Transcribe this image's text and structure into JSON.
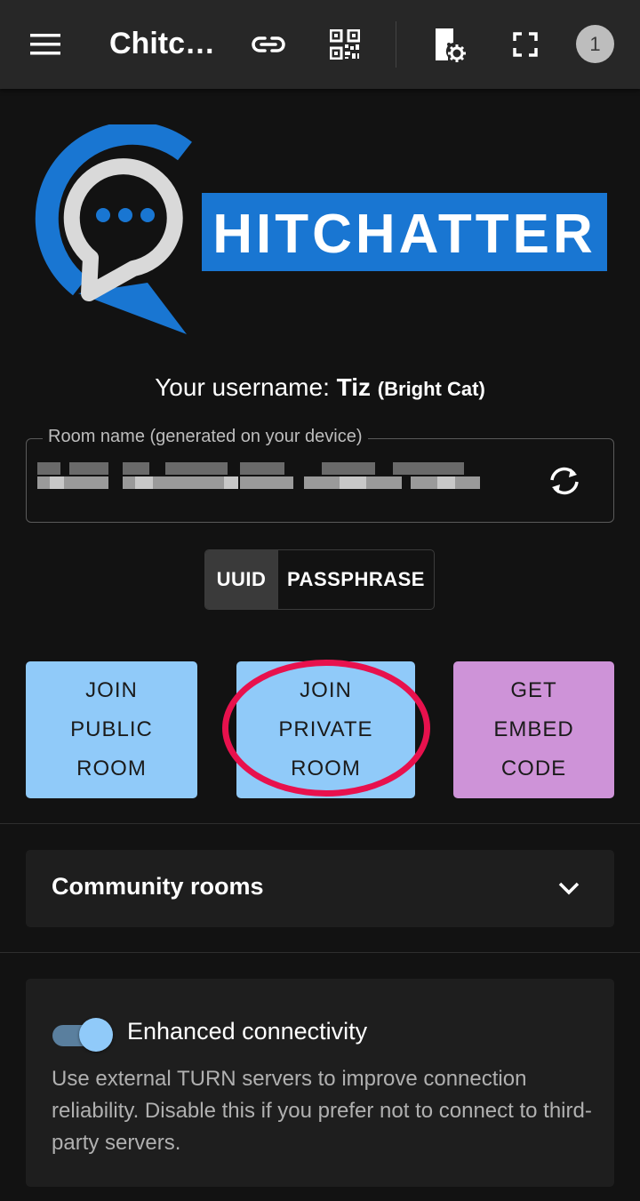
{
  "appbar": {
    "title": "Chitchatter",
    "badge_count": "1",
    "icons": [
      "menu-icon",
      "link-icon",
      "qr-code-icon",
      "room-settings-icon",
      "fullscreen-icon"
    ]
  },
  "logo": {
    "wordmark": "HITCHATTER"
  },
  "user": {
    "prefix": "Your username: ",
    "name": "Tiz",
    "nickname": "(Bright Cat)"
  },
  "room_field": {
    "label": "Room name (generated on your device)",
    "value_obscured": true
  },
  "room_type": {
    "options": [
      "UUID",
      "PASSPHRASE"
    ],
    "selected": "UUID"
  },
  "actions": {
    "join_public": [
      "JOIN",
      "PUBLIC",
      "ROOM"
    ],
    "join_private": [
      "JOIN",
      "PRIVATE",
      "ROOM"
    ],
    "get_embed": [
      "GET",
      "EMBED",
      "CODE"
    ]
  },
  "community": {
    "label": "Community rooms"
  },
  "connectivity": {
    "label": "Enhanced connectivity",
    "enabled": true,
    "description": "Use external TURN servers to improve connection reliability. Disable this if you prefer not to connect to third-party servers."
  },
  "colors": {
    "primary": "#90caf9",
    "secondary": "#ce93d8",
    "logo_blue": "#1976d2",
    "annotation": "#e8114d"
  }
}
